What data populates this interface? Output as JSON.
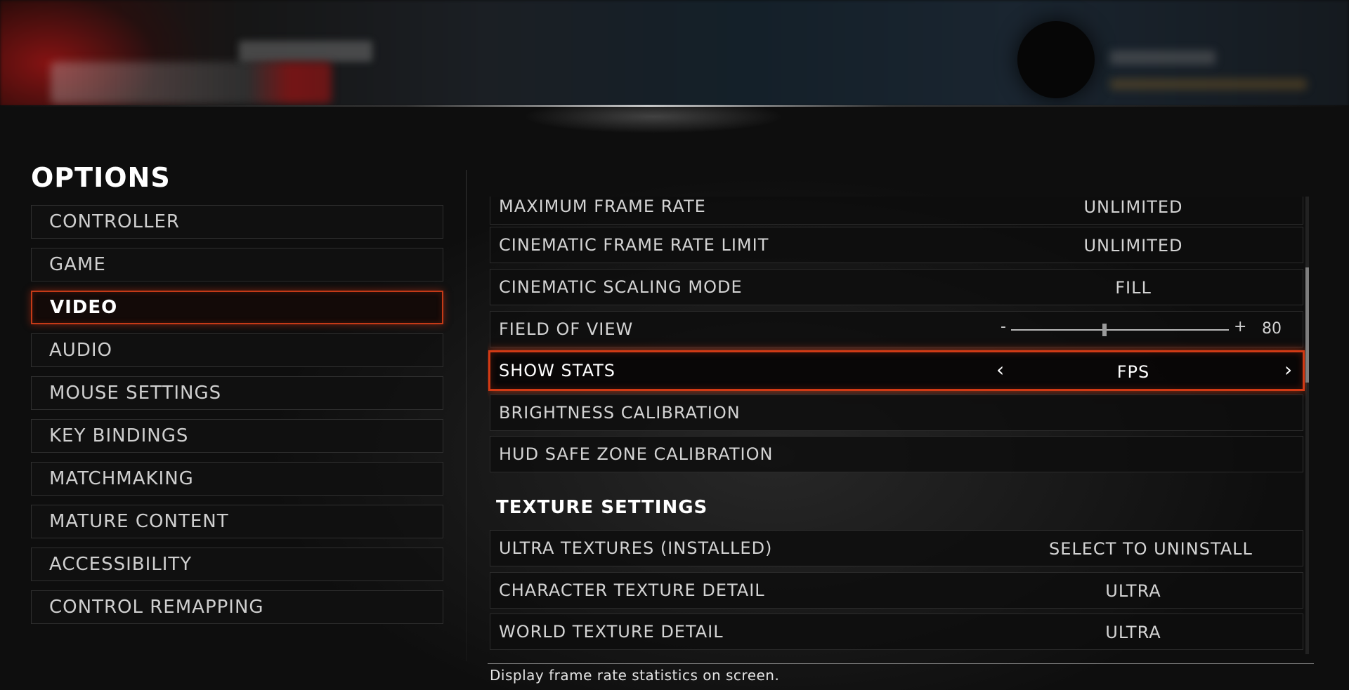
{
  "title": "OPTIONS",
  "nav": {
    "items": [
      {
        "label": "CONTROLLER"
      },
      {
        "label": "GAME"
      },
      {
        "label": "VIDEO",
        "active": true
      },
      {
        "label": "AUDIO"
      },
      {
        "label": "MOUSE SETTINGS"
      },
      {
        "label": "KEY BINDINGS"
      },
      {
        "label": "MATCHMAKING"
      },
      {
        "label": "MATURE CONTENT"
      },
      {
        "label": "ACCESSIBILITY"
      },
      {
        "label": "CONTROL REMAPPING"
      }
    ]
  },
  "settings": {
    "max_frame_rate": {
      "label": "MAXIMUM FRAME RATE",
      "value": "UNLIMITED"
    },
    "cinematic_frame_rate_limit": {
      "label": "CINEMATIC FRAME RATE LIMIT",
      "value": "UNLIMITED"
    },
    "cinematic_scaling_mode": {
      "label": "CINEMATIC SCALING MODE",
      "value": "FILL"
    },
    "field_of_view": {
      "label": "FIELD OF VIEW",
      "minus": "-",
      "plus": "+",
      "value": "80",
      "fraction": 0.43
    },
    "show_stats": {
      "label": "SHOW STATS",
      "value": "FPS",
      "left_arrow": "‹",
      "right_arrow": "›"
    },
    "brightness_calibration": {
      "label": "BRIGHTNESS CALIBRATION"
    },
    "hud_safe_zone_calibration": {
      "label": "HUD SAFE ZONE CALIBRATION"
    },
    "texture_section_title": "TEXTURE SETTINGS",
    "ultra_textures": {
      "label": "ULTRA TEXTURES (INSTALLED)",
      "value": "SELECT TO UNINSTALL"
    },
    "character_texture_detail": {
      "label": "CHARACTER TEXTURE DETAIL",
      "value": "ULTRA"
    },
    "world_texture_detail": {
      "label": "WORLD TEXTURE DETAIL",
      "value": "ULTRA"
    }
  },
  "description": "Display frame rate statistics on screen.",
  "colors": {
    "accent": "#d13a15",
    "text": "#d4d4d4",
    "background": "#101010"
  }
}
